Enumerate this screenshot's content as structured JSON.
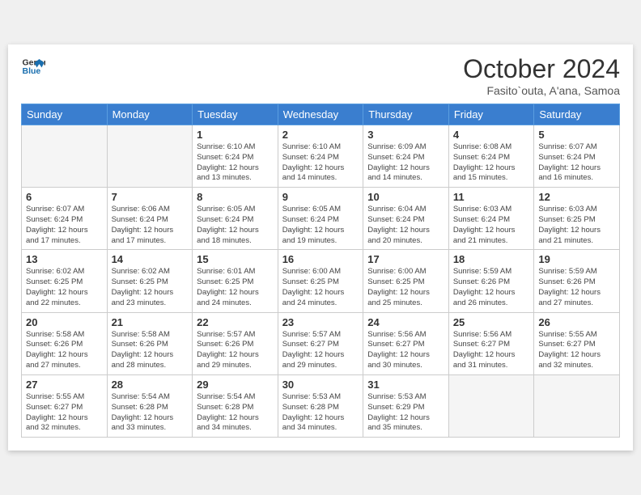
{
  "header": {
    "logo_line1": "General",
    "logo_line2": "Blue",
    "month": "October 2024",
    "location": "Fasito`outa, A'ana, Samoa"
  },
  "weekdays": [
    "Sunday",
    "Monday",
    "Tuesday",
    "Wednesday",
    "Thursday",
    "Friday",
    "Saturday"
  ],
  "weeks": [
    [
      {
        "day": "",
        "info": ""
      },
      {
        "day": "",
        "info": ""
      },
      {
        "day": "1",
        "info": "Sunrise: 6:10 AM\nSunset: 6:24 PM\nDaylight: 12 hours\nand 13 minutes."
      },
      {
        "day": "2",
        "info": "Sunrise: 6:10 AM\nSunset: 6:24 PM\nDaylight: 12 hours\nand 14 minutes."
      },
      {
        "day": "3",
        "info": "Sunrise: 6:09 AM\nSunset: 6:24 PM\nDaylight: 12 hours\nand 14 minutes."
      },
      {
        "day": "4",
        "info": "Sunrise: 6:08 AM\nSunset: 6:24 PM\nDaylight: 12 hours\nand 15 minutes."
      },
      {
        "day": "5",
        "info": "Sunrise: 6:07 AM\nSunset: 6:24 PM\nDaylight: 12 hours\nand 16 minutes."
      }
    ],
    [
      {
        "day": "6",
        "info": "Sunrise: 6:07 AM\nSunset: 6:24 PM\nDaylight: 12 hours\nand 17 minutes."
      },
      {
        "day": "7",
        "info": "Sunrise: 6:06 AM\nSunset: 6:24 PM\nDaylight: 12 hours\nand 17 minutes."
      },
      {
        "day": "8",
        "info": "Sunrise: 6:05 AM\nSunset: 6:24 PM\nDaylight: 12 hours\nand 18 minutes."
      },
      {
        "day": "9",
        "info": "Sunrise: 6:05 AM\nSunset: 6:24 PM\nDaylight: 12 hours\nand 19 minutes."
      },
      {
        "day": "10",
        "info": "Sunrise: 6:04 AM\nSunset: 6:24 PM\nDaylight: 12 hours\nand 20 minutes."
      },
      {
        "day": "11",
        "info": "Sunrise: 6:03 AM\nSunset: 6:24 PM\nDaylight: 12 hours\nand 21 minutes."
      },
      {
        "day": "12",
        "info": "Sunrise: 6:03 AM\nSunset: 6:25 PM\nDaylight: 12 hours\nand 21 minutes."
      }
    ],
    [
      {
        "day": "13",
        "info": "Sunrise: 6:02 AM\nSunset: 6:25 PM\nDaylight: 12 hours\nand 22 minutes."
      },
      {
        "day": "14",
        "info": "Sunrise: 6:02 AM\nSunset: 6:25 PM\nDaylight: 12 hours\nand 23 minutes."
      },
      {
        "day": "15",
        "info": "Sunrise: 6:01 AM\nSunset: 6:25 PM\nDaylight: 12 hours\nand 24 minutes."
      },
      {
        "day": "16",
        "info": "Sunrise: 6:00 AM\nSunset: 6:25 PM\nDaylight: 12 hours\nand 24 minutes."
      },
      {
        "day": "17",
        "info": "Sunrise: 6:00 AM\nSunset: 6:25 PM\nDaylight: 12 hours\nand 25 minutes."
      },
      {
        "day": "18",
        "info": "Sunrise: 5:59 AM\nSunset: 6:26 PM\nDaylight: 12 hours\nand 26 minutes."
      },
      {
        "day": "19",
        "info": "Sunrise: 5:59 AM\nSunset: 6:26 PM\nDaylight: 12 hours\nand 27 minutes."
      }
    ],
    [
      {
        "day": "20",
        "info": "Sunrise: 5:58 AM\nSunset: 6:26 PM\nDaylight: 12 hours\nand 27 minutes."
      },
      {
        "day": "21",
        "info": "Sunrise: 5:58 AM\nSunset: 6:26 PM\nDaylight: 12 hours\nand 28 minutes."
      },
      {
        "day": "22",
        "info": "Sunrise: 5:57 AM\nSunset: 6:26 PM\nDaylight: 12 hours\nand 29 minutes."
      },
      {
        "day": "23",
        "info": "Sunrise: 5:57 AM\nSunset: 6:27 PM\nDaylight: 12 hours\nand 29 minutes."
      },
      {
        "day": "24",
        "info": "Sunrise: 5:56 AM\nSunset: 6:27 PM\nDaylight: 12 hours\nand 30 minutes."
      },
      {
        "day": "25",
        "info": "Sunrise: 5:56 AM\nSunset: 6:27 PM\nDaylight: 12 hours\nand 31 minutes."
      },
      {
        "day": "26",
        "info": "Sunrise: 5:55 AM\nSunset: 6:27 PM\nDaylight: 12 hours\nand 32 minutes."
      }
    ],
    [
      {
        "day": "27",
        "info": "Sunrise: 5:55 AM\nSunset: 6:27 PM\nDaylight: 12 hours\nand 32 minutes."
      },
      {
        "day": "28",
        "info": "Sunrise: 5:54 AM\nSunset: 6:28 PM\nDaylight: 12 hours\nand 33 minutes."
      },
      {
        "day": "29",
        "info": "Sunrise: 5:54 AM\nSunset: 6:28 PM\nDaylight: 12 hours\nand 34 minutes."
      },
      {
        "day": "30",
        "info": "Sunrise: 5:53 AM\nSunset: 6:28 PM\nDaylight: 12 hours\nand 34 minutes."
      },
      {
        "day": "31",
        "info": "Sunrise: 5:53 AM\nSunset: 6:29 PM\nDaylight: 12 hours\nand 35 minutes."
      },
      {
        "day": "",
        "info": ""
      },
      {
        "day": "",
        "info": ""
      }
    ]
  ]
}
